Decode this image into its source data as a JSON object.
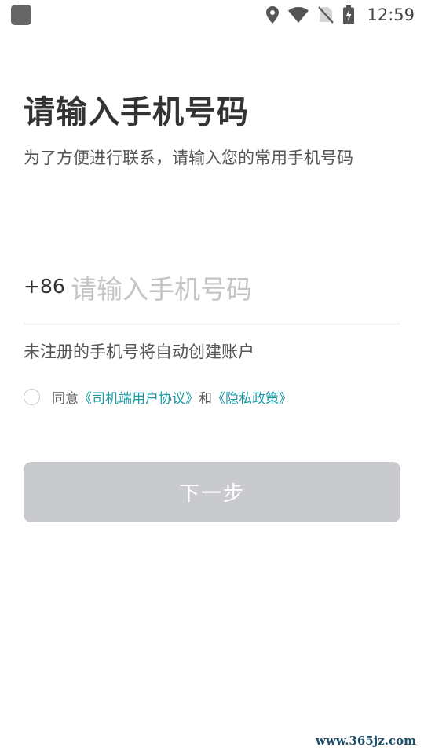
{
  "status_bar": {
    "time": "12:59",
    "icons": [
      "location-icon",
      "wifi-icon",
      "no-sim-icon",
      "battery-charging-icon"
    ]
  },
  "page": {
    "title": "请输入手机号码",
    "subtitle": "为了方便进行联系，请输入您的常用手机号码"
  },
  "phone": {
    "country_code": "+86",
    "placeholder": "请输入手机号码",
    "value": ""
  },
  "hint": "未注册的手机号将自动创建账户",
  "agreement": {
    "checked": false,
    "prefix": "同意",
    "user_agreement": "《司机端用户协议》",
    "joiner": "和",
    "privacy_policy": "《隐私政策》",
    "link_color": "#199aa6"
  },
  "next_button": {
    "label": "下一步",
    "disabled_color": "#c9cacd"
  },
  "watermark": "www.365jz.com"
}
